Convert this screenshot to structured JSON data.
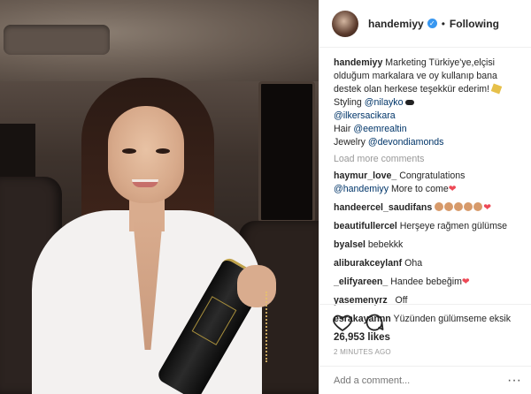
{
  "header": {
    "username": "handemiyy",
    "follow_status": "Following",
    "separator": "•"
  },
  "caption": {
    "username": "handemiyy",
    "lines": [
      "Marketing Türkiye'ye,elçisi olduğum markalara ve oy kullanıp bana destek olan herkese teşekkür ederim!",
      "Styling",
      "Hair",
      "Jewelry"
    ],
    "mentions": {
      "styling": "@nilayko",
      "secondary": "@ilkersacikara",
      "hair": "@eemrealtin",
      "jewelry": "@devondiamonds"
    }
  },
  "load_more": "Load more comments",
  "comments": [
    {
      "user": "haymur_love_",
      "text": "Congratulations",
      "mention": "@handemiyy",
      "after": " More to come"
    },
    {
      "user": "handeercel_saudifans",
      "text": ""
    },
    {
      "user": "beautifullercel",
      "text": "Herşeye rağmen gülümse"
    },
    {
      "user": "byalsel",
      "text": "bebekkk"
    },
    {
      "user": "aliburakceylanf",
      "text": "Oha"
    },
    {
      "user": "_elifyareen_",
      "text": "Handee bebeğim"
    },
    {
      "user": "yasemenyrz_",
      "text": "Off"
    },
    {
      "user": "esrakayannn",
      "text": "Yüzünden gülümseme eksik"
    }
  ],
  "likes": "26,953 likes",
  "timestamp": "2 MINUTES AGO",
  "add_comment_placeholder": "Add a comment...",
  "more_options": "···",
  "icons": {
    "verified": "verified-badge-icon",
    "like": "heart-icon",
    "comment": "comment-icon"
  },
  "colors": {
    "link": "#003569",
    "verified": "#3897f0",
    "muted": "#999999"
  }
}
